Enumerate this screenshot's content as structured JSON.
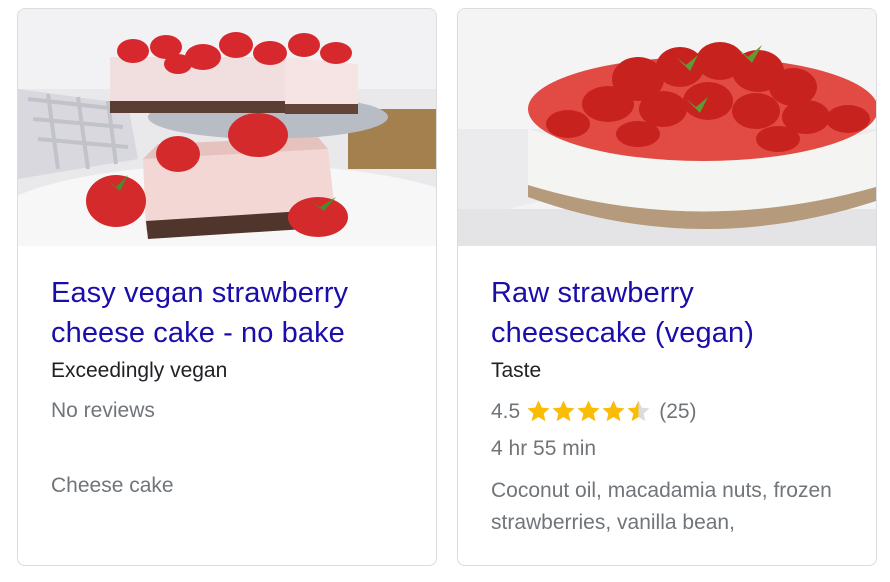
{
  "cards": [
    {
      "title": "Easy vegan strawberry cheese cake - no bake",
      "source": "Exceedingly vegan",
      "reviews": "No reviews",
      "category": "Cheese cake",
      "image": "photo of pink vegan strawberry cheesecake slice with fresh strawberries"
    },
    {
      "title": "Raw strawberry cheesecake (vegan)",
      "source": "Taste",
      "rating": "4.5",
      "rating_value": 4.5,
      "rating_max": 5,
      "review_count": "(25)",
      "time": "4 hr 55 min",
      "ingredients": "Coconut oil, macadamia nuts, frozen strawberries, vanilla bean,",
      "image": "photo of whole cheesecake topped with halved strawberries on a cake stand"
    }
  ],
  "colors": {
    "link": "#1a0dab",
    "text": "#202124",
    "muted": "#70757a",
    "star": "#fbbc04",
    "border": "#dadce0"
  },
  "icons": {
    "rating_star": "star-icon"
  }
}
